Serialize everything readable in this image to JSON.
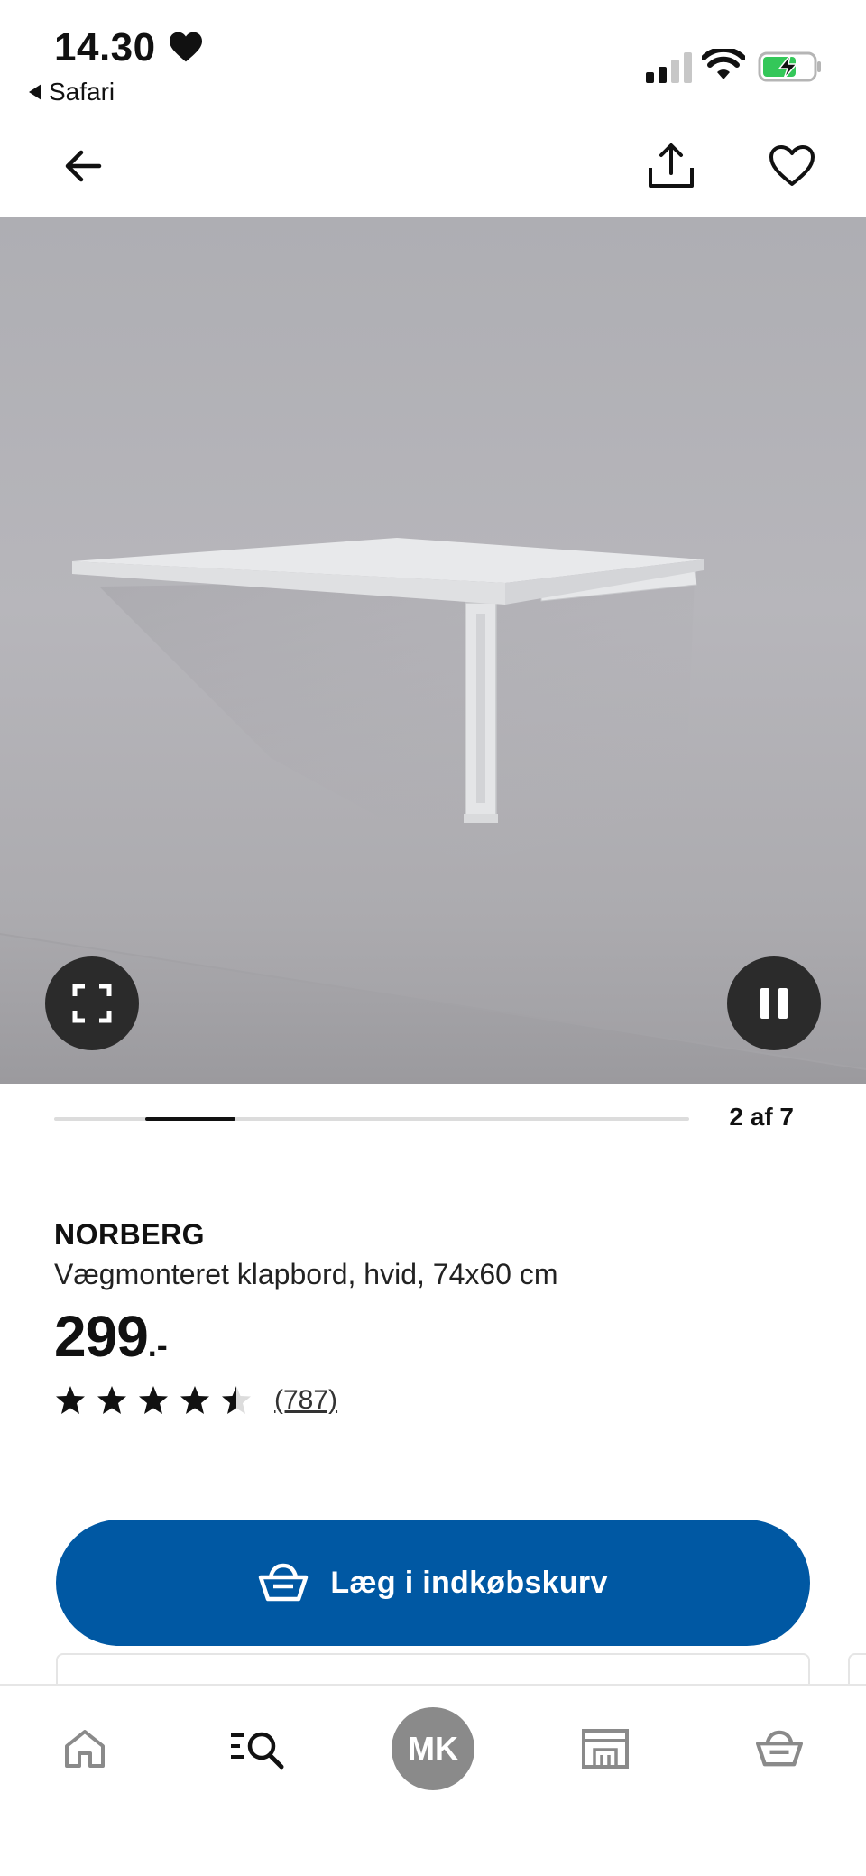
{
  "status_bar": {
    "time": "14.30",
    "back_app": "Safari"
  },
  "product": {
    "name": "NORBERG",
    "description": "Vægmonteret klapbord, hvid, 74x60 cm",
    "price_integer": "299",
    "price_suffix": ".-",
    "rating": 4.5,
    "reviews_count": "(787)"
  },
  "gallery": {
    "counter": "2 af 7",
    "current_slide": 2,
    "total_slides": 7
  },
  "actions": {
    "add_to_cart_label": "Læg i indkøbskurv"
  },
  "tab_bar": {
    "avatar_initials": "MK",
    "items": [
      "home-icon",
      "search-icon",
      "profile-avatar",
      "store-icon",
      "basket-icon"
    ]
  },
  "colors": {
    "primary": "#0058a3",
    "avatar_bg": "#8a8a8a"
  }
}
